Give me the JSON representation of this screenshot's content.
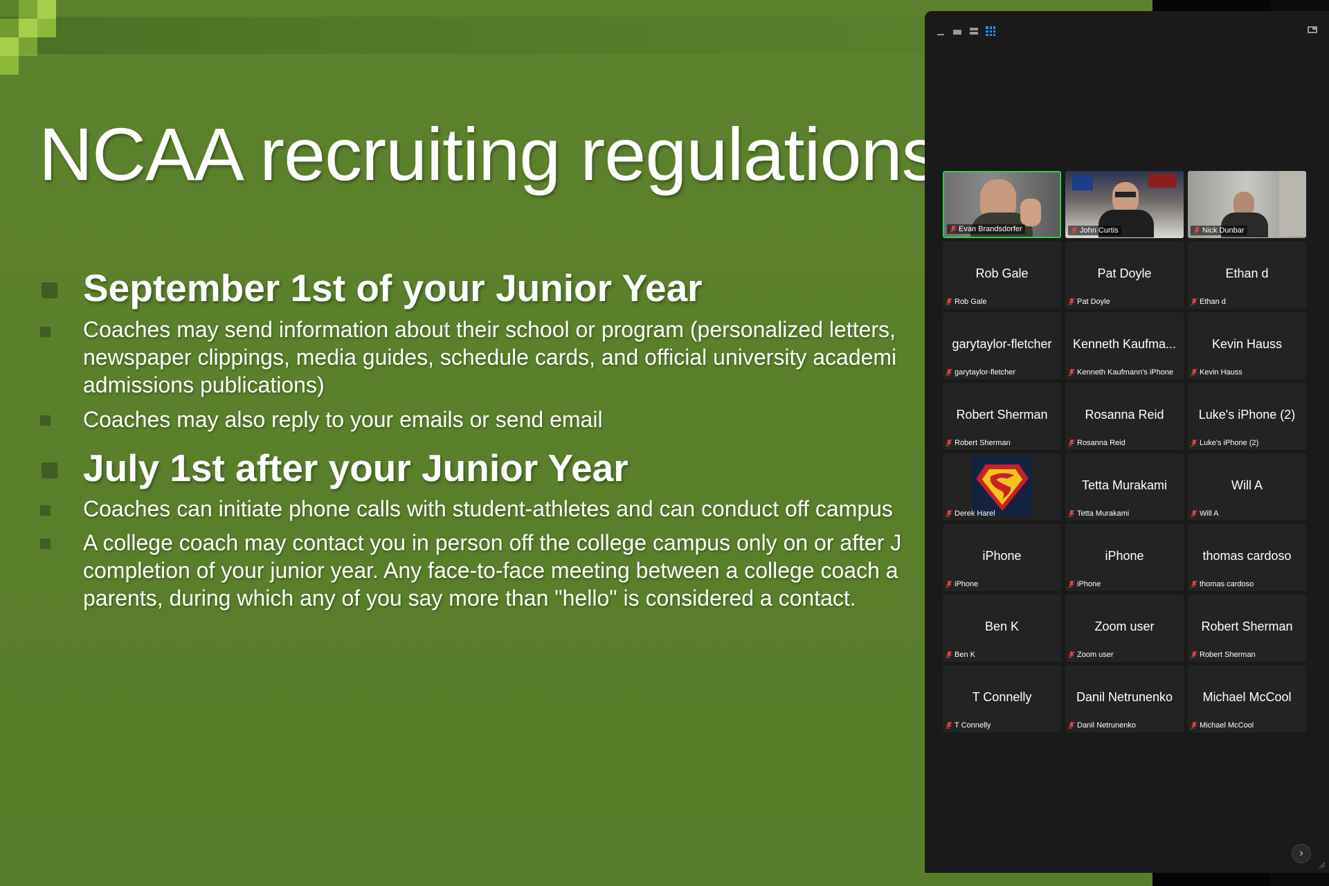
{
  "slide": {
    "title": "NCAA recruiting regulations",
    "sections": [
      {
        "heading": "September 1st of your Junior Year",
        "points": [
          "Coaches may send information about their school or program (personalized letters,\nnewspaper clippings, media guides, schedule cards, and official university academi\nadmissions publications)",
          "Coaches may also reply to your emails or send email"
        ]
      },
      {
        "heading": "July 1st after your Junior Year",
        "points": [
          "Coaches can initiate phone calls with student-athletes and can conduct off campus",
          "A college coach may contact you in person off the college campus only on or after J\ncompletion of your junior year. Any face-to-face meeting between a college coach a\nparents, during which any of you say more than \"hello\" is considered a contact."
        ]
      }
    ],
    "colors": {
      "background": "#5b7f2c",
      "bullet": "#3e5e23",
      "pixel_light": "#a6cf4e",
      "pixel_mid": "#8cb83c"
    }
  },
  "gallery": {
    "toolbar_icons": [
      "minimize-icon",
      "small-view-icon",
      "speaker-view-icon",
      "gallery-view-icon"
    ],
    "exit_icon": "exit-fullscreen-icon",
    "active_speaker_color": "#2fd24a",
    "next_page_glyph": "›",
    "participants": [
      {
        "display": "",
        "label": "Evan Brandsdorfer",
        "video": true,
        "active": true
      },
      {
        "display": "",
        "label": "John Curtis",
        "video": true,
        "active": false
      },
      {
        "display": "",
        "label": "Nick Dunbar",
        "video": true,
        "active": false
      },
      {
        "display": "Rob Gale",
        "label": "Rob Gale",
        "video": false
      },
      {
        "display": "Pat Doyle",
        "label": "Pat Doyle",
        "video": false
      },
      {
        "display": "Ethan d",
        "label": "Ethan d",
        "video": false
      },
      {
        "display": "garytaylor-fletcher",
        "label": "garytaylor-fletcher",
        "video": false
      },
      {
        "display": "Kenneth Kaufma...",
        "label": "Kenneth Kaufmann's iPhone",
        "video": false
      },
      {
        "display": "Kevin Hauss",
        "label": "Kevin Hauss",
        "video": false
      },
      {
        "display": "Robert Sherman",
        "label": "Robert Sherman",
        "video": false
      },
      {
        "display": "Rosanna Reid",
        "label": "Rosanna Reid",
        "video": false
      },
      {
        "display": "Luke's iPhone (2)",
        "label": "Luke's iPhone (2)",
        "video": false
      },
      {
        "display": "",
        "label": "Derek Harel",
        "video": false,
        "avatar": "superman-logo"
      },
      {
        "display": "Tetta Murakami",
        "label": "Tetta Murakami",
        "video": false
      },
      {
        "display": "Will A",
        "label": "Will A",
        "video": false
      },
      {
        "display": "iPhone",
        "label": "iPhone",
        "video": false
      },
      {
        "display": "iPhone",
        "label": "iPhone",
        "video": false
      },
      {
        "display": "thomas cardoso",
        "label": "thomas cardoso",
        "video": false
      },
      {
        "display": "Ben K",
        "label": "Ben K",
        "video": false
      },
      {
        "display": "Zoom user",
        "label": "Zoom user",
        "video": false
      },
      {
        "display": "Robert Sherman",
        "label": "Robert Sherman",
        "video": false
      },
      {
        "display": "T Connelly",
        "label": "T Connelly",
        "video": false
      },
      {
        "display": "Danil Netrunenko",
        "label": "Danil Netrunenko",
        "video": false
      },
      {
        "display": "Michael McCool",
        "label": "Michael McCool",
        "video": false
      }
    ]
  }
}
